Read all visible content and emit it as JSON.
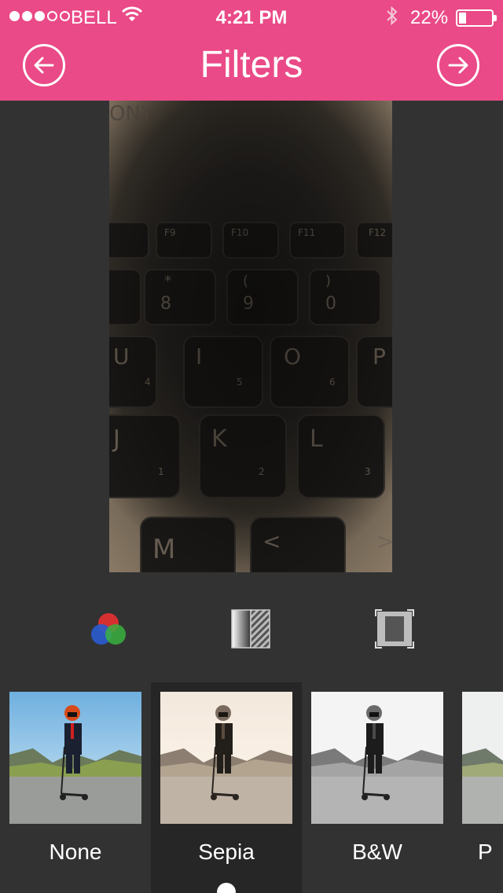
{
  "status_bar": {
    "carrier": "BELL",
    "time": "4:21 PM",
    "battery_percent": "22%",
    "signal_bars_filled": 3,
    "signal_bars_total": 5
  },
  "nav": {
    "title": "Filters",
    "back_icon": "arrow-left-circle-icon",
    "next_icon": "arrow-right-circle-icon"
  },
  "colors": {
    "brand": "#ea4a87",
    "background": "#323232",
    "selected_tile": "#262626"
  },
  "tools": [
    {
      "name": "color-adjust",
      "icon": "rgb-circles-icon"
    },
    {
      "name": "gradient",
      "icon": "gradient-hatch-icon"
    },
    {
      "name": "frame",
      "icon": "frame-icon"
    }
  ],
  "filters": [
    {
      "label": "None",
      "selected": false
    },
    {
      "label": "Sepia",
      "selected": true
    },
    {
      "label": "B&W",
      "selected": false
    },
    {
      "label": "P",
      "selected": false
    }
  ]
}
